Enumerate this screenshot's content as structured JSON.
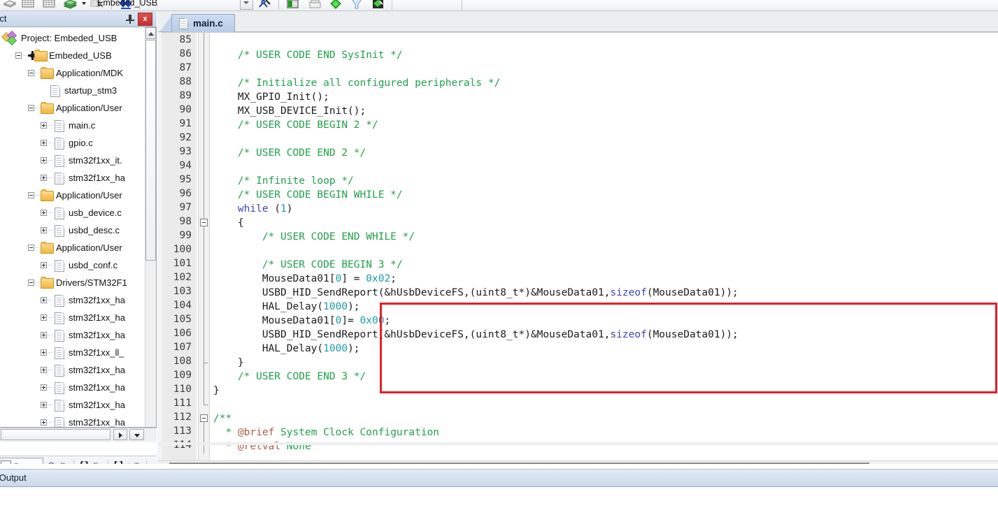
{
  "toolbar": {
    "project_name": "Embeded_USB",
    "icons": [
      "build-target-icon",
      "insert-table-icon",
      "insert-table-2-icon",
      "rebuild-icon",
      "dropdown-arrow-icon",
      "batch-build-icon",
      "download-icon",
      "target-options-icon",
      "configuration-wizard-icon",
      "manage-project-items-icon",
      "debug-start-icon",
      "logic-analyzer-icon",
      "pack-installer-icon"
    ]
  },
  "project_panel": {
    "title": "oject",
    "pin_label": "auto-hide",
    "close_label": "x",
    "tree": [
      {
        "indent": 0,
        "label": "Project: Embeded_USB",
        "icon": "project-icon",
        "expander": "none"
      },
      {
        "indent": 1,
        "label": "Embeded_USB",
        "icon": "target-icon",
        "expander": "minus"
      },
      {
        "indent": 2,
        "label": "Application/MDK",
        "icon": "folder-icon",
        "expander": "minus"
      },
      {
        "indent": 3,
        "label": "startup_stm3",
        "icon": "file-icon",
        "expander": "none"
      },
      {
        "indent": 2,
        "label": "Application/User",
        "icon": "folder-icon",
        "expander": "minus"
      },
      {
        "indent": 3,
        "label": "main.c",
        "icon": "file-icon",
        "expander": "plus"
      },
      {
        "indent": 3,
        "label": "gpio.c",
        "icon": "file-icon",
        "expander": "plus"
      },
      {
        "indent": 3,
        "label": "stm32f1xx_it.",
        "icon": "file-icon",
        "expander": "plus"
      },
      {
        "indent": 3,
        "label": "stm32f1xx_ha",
        "icon": "file-icon",
        "expander": "plus"
      },
      {
        "indent": 2,
        "label": "Application/User",
        "icon": "folder-icon",
        "expander": "minus"
      },
      {
        "indent": 3,
        "label": "usb_device.c",
        "icon": "file-icon",
        "expander": "plus"
      },
      {
        "indent": 3,
        "label": "usbd_desc.c",
        "icon": "file-icon",
        "expander": "plus"
      },
      {
        "indent": 2,
        "label": "Application/User",
        "icon": "folder-icon",
        "expander": "minus"
      },
      {
        "indent": 3,
        "label": "usbd_conf.c",
        "icon": "file-icon",
        "expander": "plus"
      },
      {
        "indent": 2,
        "label": "Drivers/STM32F1",
        "icon": "folder-icon",
        "expander": "minus"
      },
      {
        "indent": 3,
        "label": "stm32f1xx_ha",
        "icon": "file-icon",
        "expander": "plus"
      },
      {
        "indent": 3,
        "label": "stm32f1xx_ha",
        "icon": "file-icon",
        "expander": "plus"
      },
      {
        "indent": 3,
        "label": "stm32f1xx_ha",
        "icon": "file-icon",
        "expander": "plus"
      },
      {
        "indent": 3,
        "label": "stm32f1xx_ll_",
        "icon": "file-icon",
        "expander": "plus"
      },
      {
        "indent": 3,
        "label": "stm32f1xx_ha",
        "icon": "file-icon",
        "expander": "plus"
      },
      {
        "indent": 3,
        "label": "stm32f1xx_ha",
        "icon": "file-icon",
        "expander": "plus"
      },
      {
        "indent": 3,
        "label": "stm32f1xx_ha",
        "icon": "file-icon",
        "expander": "plus"
      },
      {
        "indent": 3,
        "label": "stm32f1xx_ha",
        "icon": "file-icon",
        "expander": "plus"
      }
    ],
    "tabs": [
      {
        "label": "Pr...",
        "icon": "project-tab-icon",
        "active": true
      },
      {
        "label": "B...",
        "icon": "books-icon",
        "active": false
      },
      {
        "label": "F...",
        "icon": "functions-icon",
        "active": false
      },
      {
        "label": "Te...",
        "icon": "templates-icon",
        "active": false
      }
    ]
  },
  "editor": {
    "tabs": [
      {
        "label": "main.c",
        "icon": "c-file-icon",
        "active": true
      }
    ],
    "first_line": 85,
    "lines": [
      {
        "n": 85,
        "indent": 0,
        "tokens": []
      },
      {
        "n": 86,
        "indent": 2,
        "tokens": [
          {
            "t": "/* USER CODE END SysInit */",
            "c": "cmt"
          }
        ]
      },
      {
        "n": 87,
        "indent": 0,
        "tokens": []
      },
      {
        "n": 88,
        "indent": 2,
        "tokens": [
          {
            "t": "/* Initialize all configured peripherals */",
            "c": "cmt"
          }
        ]
      },
      {
        "n": 89,
        "indent": 2,
        "tokens": [
          {
            "t": "MX_GPIO_Init();",
            "c": "pun"
          }
        ]
      },
      {
        "n": 90,
        "indent": 2,
        "tokens": [
          {
            "t": "MX_USB_DEVICE_Init();",
            "c": "pun"
          }
        ]
      },
      {
        "n": 91,
        "indent": 2,
        "tokens": [
          {
            "t": "/* USER CODE BEGIN 2 */",
            "c": "cmt"
          }
        ]
      },
      {
        "n": 92,
        "indent": 0,
        "tokens": []
      },
      {
        "n": 93,
        "indent": 2,
        "tokens": [
          {
            "t": "/* USER CODE END 2 */",
            "c": "cmt"
          }
        ]
      },
      {
        "n": 94,
        "indent": 0,
        "tokens": []
      },
      {
        "n": 95,
        "indent": 2,
        "tokens": [
          {
            "t": "/* Infinite loop */",
            "c": "cmt"
          }
        ]
      },
      {
        "n": 96,
        "indent": 2,
        "tokens": [
          {
            "t": "/* USER CODE BEGIN WHILE */",
            "c": "cmt"
          }
        ]
      },
      {
        "n": 97,
        "indent": 2,
        "tokens": [
          {
            "t": "while",
            "c": "kw"
          },
          {
            "t": " (",
            "c": "pun"
          },
          {
            "t": "1",
            "c": "num"
          },
          {
            "t": ")",
            "c": "pun"
          }
        ]
      },
      {
        "n": 98,
        "indent": 2,
        "tokens": [
          {
            "t": "{",
            "c": "pun"
          }
        ],
        "fold": "open"
      },
      {
        "n": 99,
        "indent": 4,
        "tokens": [
          {
            "t": "/* USER CODE END WHILE */",
            "c": "cmt"
          }
        ]
      },
      {
        "n": 100,
        "indent": 0,
        "tokens": []
      },
      {
        "n": 101,
        "indent": 4,
        "tokens": [
          {
            "t": "/* USER CODE BEGIN 3 */",
            "c": "cmt"
          }
        ]
      },
      {
        "n": 102,
        "indent": 4,
        "tokens": [
          {
            "t": "MouseData01[",
            "c": "pun"
          },
          {
            "t": "0",
            "c": "num"
          },
          {
            "t": "] = ",
            "c": "pun"
          },
          {
            "t": "0x02",
            "c": "num"
          },
          {
            "t": ";",
            "c": "pun"
          }
        ]
      },
      {
        "n": 103,
        "indent": 4,
        "tokens": [
          {
            "t": "USBD_HID_SendReport(&hUsbDeviceFS,(uint8_t*)&MouseData01,",
            "c": "pun"
          },
          {
            "t": "sizeof",
            "c": "kw"
          },
          {
            "t": "(MouseData01));",
            "c": "pun"
          }
        ]
      },
      {
        "n": 104,
        "indent": 4,
        "tokens": [
          {
            "t": "HAL_Delay(",
            "c": "pun"
          },
          {
            "t": "1000",
            "c": "num"
          },
          {
            "t": ");",
            "c": "pun"
          }
        ]
      },
      {
        "n": 105,
        "indent": 4,
        "tokens": [
          {
            "t": "MouseData01[",
            "c": "pun"
          },
          {
            "t": "0",
            "c": "num"
          },
          {
            "t": "]= ",
            "c": "pun"
          },
          {
            "t": "0x00",
            "c": "num"
          },
          {
            "t": ";",
            "c": "pun"
          }
        ]
      },
      {
        "n": 106,
        "indent": 4,
        "tokens": [
          {
            "t": "USBD_HID_SendReport(&hUsbDeviceFS,(uint8_t*)&MouseData01,",
            "c": "pun"
          },
          {
            "t": "sizeof",
            "c": "kw"
          },
          {
            "t": "(MouseData01));",
            "c": "pun"
          }
        ]
      },
      {
        "n": 107,
        "indent": 4,
        "tokens": [
          {
            "t": "HAL_Delay(",
            "c": "pun"
          },
          {
            "t": "1000",
            "c": "num"
          },
          {
            "t": ");",
            "c": "pun"
          }
        ]
      },
      {
        "n": 108,
        "indent": 2,
        "tokens": [
          {
            "t": "}",
            "c": "pun"
          }
        ],
        "fold": "end"
      },
      {
        "n": 109,
        "indent": 2,
        "tokens": [
          {
            "t": "/* USER CODE END 3 */",
            "c": "cmt"
          }
        ]
      },
      {
        "n": 110,
        "indent": 0,
        "tokens": [
          {
            "t": "}",
            "c": "pun"
          }
        ]
      },
      {
        "n": 111,
        "indent": 0,
        "tokens": []
      },
      {
        "n": 112,
        "indent": 0,
        "tokens": [
          {
            "t": "/**",
            "c": "cmt"
          }
        ],
        "fold": "open"
      },
      {
        "n": 113,
        "indent": 1,
        "tokens": [
          {
            "t": "* ",
            "c": "cmt"
          },
          {
            "t": "@brief",
            "c": "cmt-b"
          },
          {
            "t": " System Clock Configuration",
            "c": "cmt"
          }
        ]
      },
      {
        "n": 114,
        "indent": 1,
        "tokens": [
          {
            "t": "* ",
            "c": "cmt"
          },
          {
            "t": "@retval",
            "c": "cmt-b"
          },
          {
            "t": " None",
            "c": "cmt"
          }
        ]
      }
    ],
    "highlight_box_color": "#e81d26"
  },
  "build_output": {
    "title": "ld Output"
  }
}
